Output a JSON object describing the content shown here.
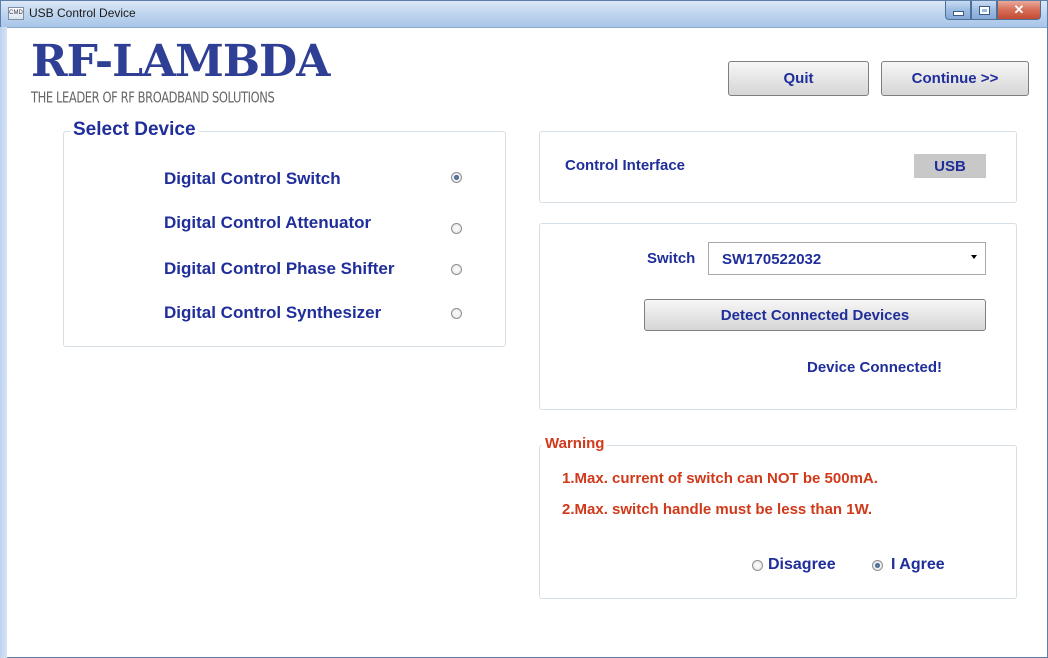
{
  "window": {
    "title": "USB Control Device",
    "icon_text": "CMD"
  },
  "logo": {
    "main": "RF-LAMBDA",
    "tagline": "THE LEADER OF RF BROADBAND SOLUTIONS"
  },
  "toolbar": {
    "quit_label": "Quit",
    "continue_label": "Continue >>"
  },
  "select_device": {
    "title": "Select Device",
    "options": [
      {
        "label": "Digital Control Switch",
        "selected": true
      },
      {
        "label": "Digital Control Attenuator",
        "selected": false
      },
      {
        "label": "Digital Control Phase Shifter",
        "selected": false
      },
      {
        "label": "Digital Control Synthesizer",
        "selected": false
      }
    ]
  },
  "control_interface": {
    "label": "Control Interface",
    "value": "USB"
  },
  "device": {
    "switch_label": "Switch",
    "switch_value": "SW170522032",
    "detect_label": "Detect Connected Devices",
    "status": "Device Connected!"
  },
  "warning": {
    "title": "Warning",
    "lines": [
      "1.Max. current of switch can NOT be 500mA.",
      "2.Max. switch handle must be less than 1W."
    ],
    "disagree_label": "Disagree",
    "agree_label": "I Agree",
    "agreed": true
  },
  "colors": {
    "label_blue": "#1f2e9a",
    "warning_red": "#d0391a",
    "logo_blue": "#2e3f95"
  }
}
